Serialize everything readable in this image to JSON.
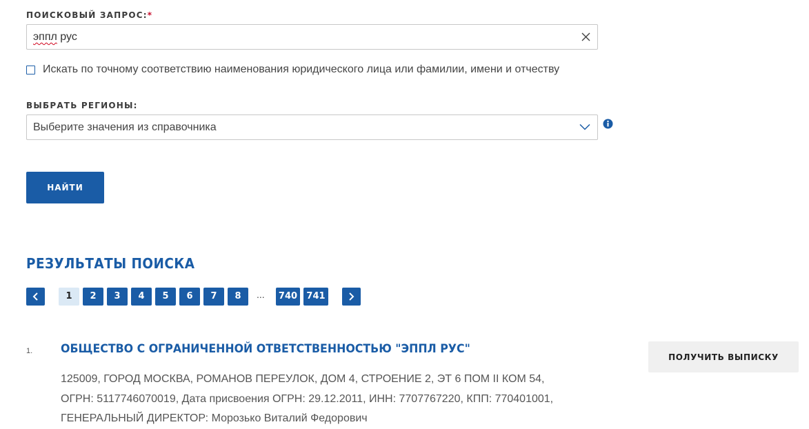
{
  "search": {
    "label": "ПОИСКОВЫЙ ЗАПРОС:",
    "required_mark": "*",
    "value_word1": "эппл",
    "value_rest": " рус"
  },
  "exact_match": {
    "label": "Искать по точному соответствию наименования юридического лица или фамилии, имени и отчеству",
    "checked": false
  },
  "regions": {
    "label": "ВЫБРАТЬ РЕГИОНЫ:",
    "placeholder": "Выберите значения из справочника"
  },
  "search_button": "НАЙТИ",
  "results": {
    "title": "РЕЗУЛЬТАТЫ ПОИСКА",
    "pagination": {
      "pages": [
        "1",
        "2",
        "3",
        "4",
        "5",
        "6",
        "7",
        "8"
      ],
      "current": "1",
      "ellipsis": "...",
      "last_pages": [
        "740",
        "741"
      ]
    },
    "items": [
      {
        "number": "1.",
        "name": "ОБЩЕСТВО С ОГРАНИЧЕННОЙ ОТВЕТСТВЕННОСТЬЮ \"ЭППЛ РУС\"",
        "address": "125009, ГОРОД МОСКВА, РОМАНОВ ПЕРЕУЛОК, ДОМ 4, СТРОЕНИЕ 2, ЭТ 6 ПОМ II КОМ 54,",
        "details": "ОГРН: 5117746070019, Дата присвоения ОГРН: 29.12.2011, ИНН: 7707767220, КПП: 770401001,",
        "director": "ГЕНЕРАЛЬНЫЙ ДИРЕКТОР: Морозько Виталий Федорович",
        "action_label": "ПОЛУЧИТЬ ВЫПИСКУ"
      }
    ]
  },
  "colors": {
    "accent": "#1a5ca6",
    "required": "#c8102e",
    "active_page_bg": "#dbe9f5",
    "secondary_button_bg": "#f0f0f0"
  },
  "icons": {
    "clear": "close-icon",
    "dropdown": "chevron-down-icon",
    "info": "info-icon",
    "prev": "chevron-left-icon",
    "next": "chevron-right-icon"
  }
}
